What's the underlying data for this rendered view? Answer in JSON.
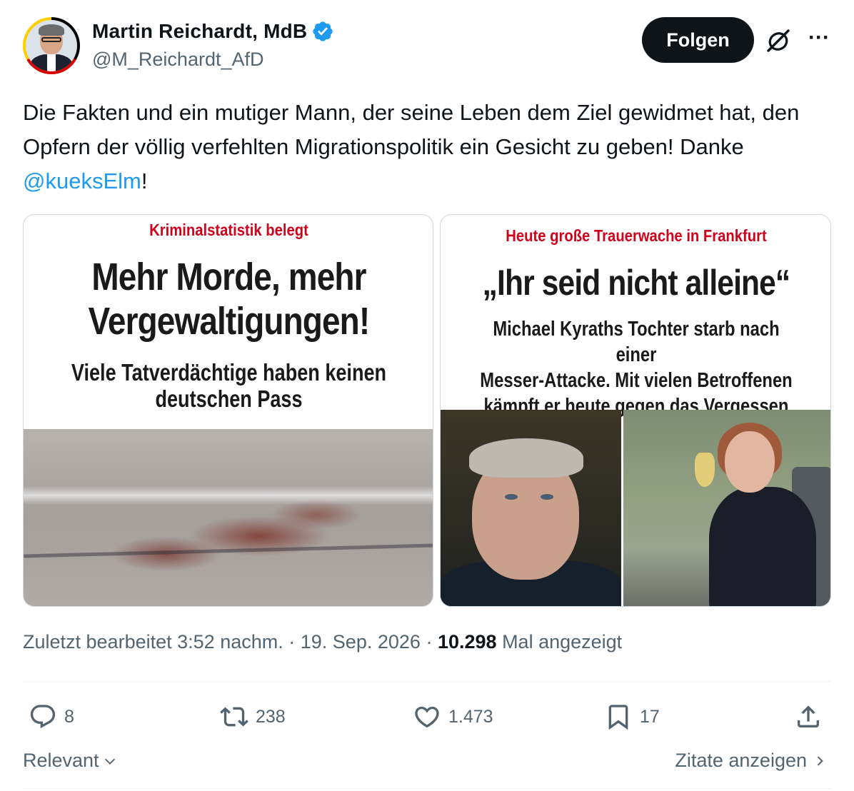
{
  "author": {
    "name": "Martin Reichardt, MdB",
    "handle": "@M_Reichardt_AfD",
    "verified_color": "#1d9bf0"
  },
  "header": {
    "follow_label": "Folgen",
    "grok_icon": "grok-icon",
    "more_icon": "more-icon"
  },
  "tweet": {
    "text_before": "Die Fakten und ein mutiger Mann, der seine Leben dem Ziel gewidmet hat, den Opfern der völlig verfehlten Migrationspolitik ein Gesicht zu geben! Danke ",
    "mention": "@kueksElm",
    "text_after": "!"
  },
  "media": {
    "left": {
      "kicker": "Kriminalstatistik belegt",
      "headline_line1": "Mehr Morde, mehr",
      "headline_line2": "Vergewaltigungen!",
      "sub_line1": "Viele Tatverdächtige haben keinen",
      "sub_line2": "deutschen Pass"
    },
    "right": {
      "kicker": "Heute große Trauerwache in Frankfurt",
      "headline": "„Ihr seid nicht alleine“",
      "sub_line1": "Michael Kyraths Tochter starb nach einer",
      "sub_line2": "Messer-Attacke. Mit vielen Betroffenen",
      "sub_line3": "kämpft er heute gegen das Vergessen"
    }
  },
  "meta": {
    "edited_prefix": "Zuletzt bearbeitet",
    "time": "3:52 nachm.",
    "sep": "·",
    "date": "19. Sep. 2026",
    "views": "10.298",
    "views_label": "Mal angezeigt"
  },
  "actions": {
    "replies": "8",
    "reposts": "238",
    "likes": "1.473",
    "bookmarks": "17"
  },
  "footer": {
    "sort_label": "Relevant",
    "quotes_label": "Zitate anzeigen"
  },
  "colors": {
    "text": "#0f1419",
    "secondary": "#536471",
    "link": "#1d9bf0",
    "news_red": "#d0021b"
  }
}
